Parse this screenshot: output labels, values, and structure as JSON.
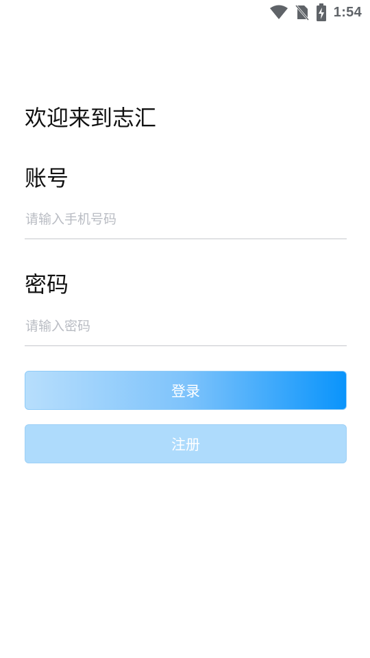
{
  "status_bar": {
    "time": "1:54",
    "icons": [
      "wifi-icon",
      "no-sim-icon",
      "battery-charging-icon"
    ]
  },
  "main": {
    "welcome": "欢迎来到志汇",
    "account_label": "账号",
    "account_placeholder": "请输入手机号码",
    "account_value": "",
    "password_label": "密码",
    "password_placeholder": "请输入密码",
    "password_value": "",
    "login_label": "登录",
    "register_label": "注册"
  },
  "colors": {
    "login_gradient_start": "#b7defc",
    "login_gradient_end": "#0a94fb",
    "register_bg": "#aedbfc",
    "divider": "#c5c7cc",
    "placeholder": "#b9bcc3"
  }
}
